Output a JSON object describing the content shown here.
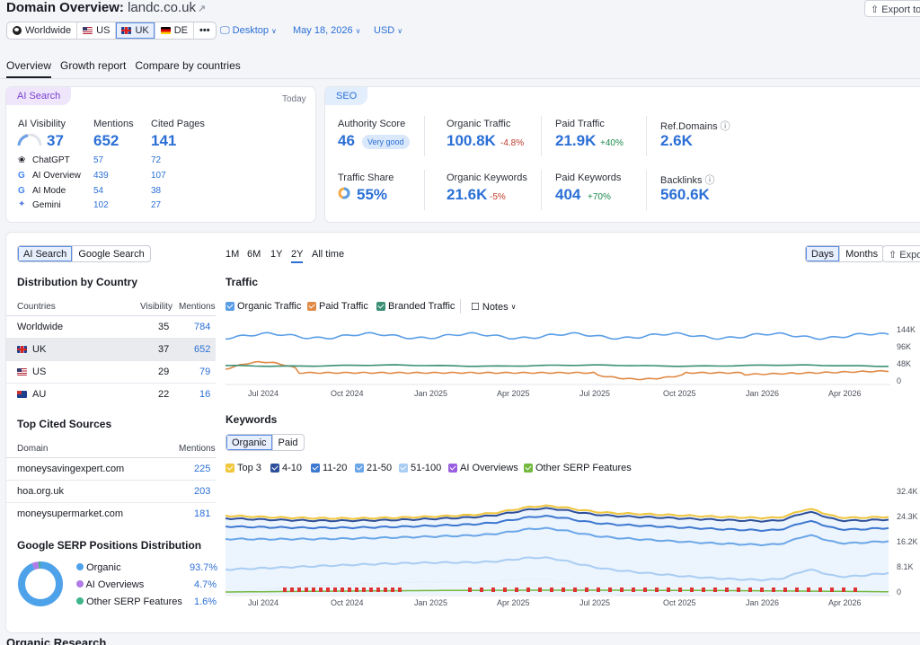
{
  "header": {
    "title": "Domain Overview:",
    "domain": "landc.co.uk",
    "export_label": "Export to",
    "databases": [
      {
        "label": "Worldwide",
        "icon": "globe-icon"
      },
      {
        "label": "US",
        "icon": "us-flag-icon"
      },
      {
        "label": "UK",
        "icon": "uk-flag-icon",
        "selected": true
      },
      {
        "label": "DE",
        "icon": "de-flag-icon"
      }
    ],
    "more_label": "•••",
    "device": "Desktop",
    "date": "May 18, 2026",
    "currency": "USD"
  },
  "tabs": [
    "Overview",
    "Growth report",
    "Compare by countries"
  ],
  "ai_search": {
    "pill": "AI Search",
    "period": "Today",
    "visibility_label": "AI Visibility",
    "visibility_value": "37",
    "mentions_label": "Mentions",
    "mentions_value": "652",
    "cited_label": "Cited Pages",
    "cited_value": "141",
    "rows": [
      {
        "name": "ChatGPT",
        "mentions": "57",
        "cited": "72"
      },
      {
        "name": "AI Overview",
        "mentions": "439",
        "cited": "107"
      },
      {
        "name": "AI Mode",
        "mentions": "54",
        "cited": "38"
      },
      {
        "name": "Gemini",
        "mentions": "102",
        "cited": "27"
      }
    ]
  },
  "seo": {
    "pill": "SEO",
    "authority_label": "Authority Score",
    "authority_value": "46",
    "authority_badge": "Very good",
    "organic_traffic_label": "Organic Traffic",
    "organic_traffic_value": "100.8K",
    "organic_traffic_change": "-4.8%",
    "paid_traffic_label": "Paid Traffic",
    "paid_traffic_value": "21.9K",
    "paid_traffic_change": "+40%",
    "ref_domains_label": "Ref.Domains",
    "ref_domains_value": "2.6K",
    "traffic_share_label": "Traffic Share",
    "traffic_share_value": "55%",
    "organic_kw_label": "Organic Keywords",
    "organic_kw_value": "21.6K",
    "organic_kw_change": "-5%",
    "paid_kw_label": "Paid Keywords",
    "paid_kw_value": "404",
    "paid_kw_change": "+70%",
    "backlinks_label": "Backlinks",
    "backlinks_value": "560.6K"
  },
  "left_panel": {
    "toggle": [
      "AI Search",
      "Google Search"
    ],
    "distribution_title": "Distribution by Country",
    "dist_headers": [
      "Countries",
      "Visibility",
      "Mentions"
    ],
    "dist_rows": [
      {
        "country": "Worldwide",
        "visibility": "35",
        "mentions": "784"
      },
      {
        "country": "UK",
        "visibility": "37",
        "mentions": "652"
      },
      {
        "country": "US",
        "visibility": "29",
        "mentions": "79"
      },
      {
        "country": "AU",
        "visibility": "22",
        "mentions": "16"
      }
    ],
    "cited_title": "Top Cited Sources",
    "cited_headers": [
      "Domain",
      "Mentions"
    ],
    "cited_rows": [
      {
        "domain": "moneysavingexpert.com",
        "mentions": "225"
      },
      {
        "domain": "hoa.org.uk",
        "mentions": "203"
      },
      {
        "domain": "moneysupermarket.com",
        "mentions": "181"
      }
    ],
    "serp_title": "Google SERP Positions Distribution",
    "serp_rows": [
      {
        "label": "Organic",
        "value": "93.7%",
        "pct": 93.7,
        "color": "#4ea2ea"
      },
      {
        "label": "AI Overviews",
        "value": "4.7%",
        "pct": 4.7,
        "color": "#b07ce8"
      },
      {
        "label": "Other SERP Features",
        "value": "1.6%",
        "pct": 1.6,
        "color": "#3fb58a"
      }
    ]
  },
  "charts_panel": {
    "ranges": [
      "1M",
      "6M",
      "1Y",
      "2Y",
      "All time"
    ],
    "selected_range": "2Y",
    "granularity": [
      "Days",
      "Months"
    ],
    "export_label": "Expo",
    "traffic_title": "Traffic",
    "traffic_legend": [
      {
        "label": "Organic Traffic",
        "color": "#5a9ee6"
      },
      {
        "label": "Paid Traffic",
        "color": "#e08a46"
      },
      {
        "label": "Branded Traffic",
        "color": "#3a8f74"
      }
    ],
    "notes_label": "Notes",
    "traffic_y_ticks": [
      "144K",
      "96K",
      "48K",
      "0"
    ],
    "x_ticks": [
      "Jul 2024",
      "Oct 2024",
      "Jan 2025",
      "Apr 2025",
      "Jul 2025",
      "Oct 2025",
      "Jan 2026",
      "Apr 2026"
    ],
    "keywords_title": "Keywords",
    "keywords_toggle": [
      "Organic",
      "Paid"
    ],
    "keywords_legend": [
      {
        "label": "Top 3",
        "color": "#f0c63a"
      },
      {
        "label": "4-10",
        "color": "#2e4f9a"
      },
      {
        "label": "11-20",
        "color": "#3e78d0"
      },
      {
        "label": "21-50",
        "color": "#6aa6e8"
      },
      {
        "label": "51-100",
        "color": "#a9cdf3"
      },
      {
        "label": "AI Overviews",
        "color": "#9a5fe0"
      },
      {
        "label": "Other SERP Features",
        "color": "#74b83e"
      }
    ],
    "keywords_y_ticks": [
      "32.4K",
      "24.3K",
      "16.2K",
      "8.1K",
      "0"
    ]
  },
  "bottom_heading": "Organic Research"
}
